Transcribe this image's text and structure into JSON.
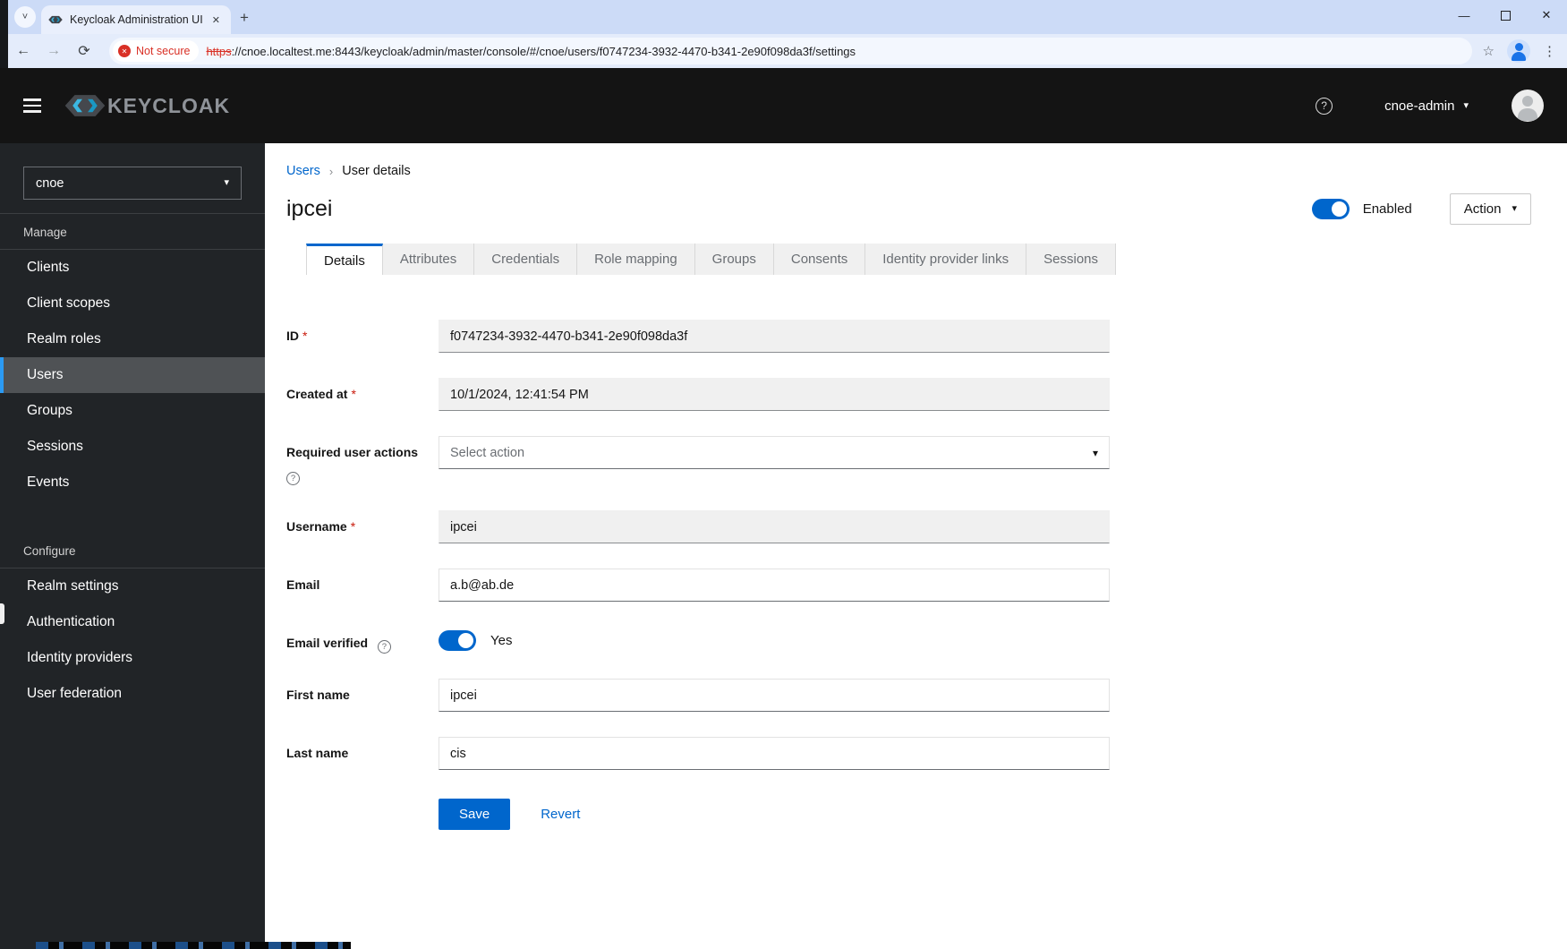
{
  "browser": {
    "tab_title": "Keycloak Administration UI",
    "not_secure": "Not secure",
    "url_scheme": "https",
    "url_rest": "://cnoe.localtest.me:8443/keycloak/admin/master/console/#/cnoe/users/f0747234-3932-4470-b341-2e90f098da3f/settings"
  },
  "masthead": {
    "brand": "KEYCLOAK",
    "user": "cnoe-admin"
  },
  "sidebar": {
    "realm": "cnoe",
    "manage_title": "Manage",
    "configure_title": "Configure",
    "manage_items": [
      "Clients",
      "Client scopes",
      "Realm roles",
      "Users",
      "Groups",
      "Sessions",
      "Events"
    ],
    "configure_items": [
      "Realm settings",
      "Authentication",
      "Identity providers",
      "User federation"
    ],
    "active_item": "Users"
  },
  "page": {
    "breadcrumb": {
      "parent": "Users",
      "current": "User details"
    },
    "title": "ipcei",
    "enabled_label": "Enabled",
    "action_label": "Action",
    "tabs": [
      "Details",
      "Attributes",
      "Credentials",
      "Role mapping",
      "Groups",
      "Consents",
      "Identity provider links",
      "Sessions"
    ],
    "active_tab": "Details"
  },
  "form": {
    "required_marker": "*",
    "id": {
      "label": "ID",
      "value": "f0747234-3932-4470-b341-2e90f098da3f"
    },
    "created_at": {
      "label": "Created at",
      "value": "10/1/2024, 12:41:54 PM"
    },
    "required_actions": {
      "label": "Required user actions",
      "placeholder": "Select action"
    },
    "username": {
      "label": "Username",
      "value": "ipcei"
    },
    "email": {
      "label": "Email",
      "value": "a.b@ab.de"
    },
    "email_verified": {
      "label": "Email verified",
      "state": "Yes"
    },
    "first_name": {
      "label": "First name",
      "value": "ipcei"
    },
    "last_name": {
      "label": "Last name",
      "value": "cis"
    },
    "save": "Save",
    "revert": "Revert"
  },
  "icons": {
    "chevron_down": "▾",
    "chevron_down_small": "˅",
    "breadcrumb_sep": "›",
    "help": "?",
    "close": "✕",
    "minimize": "—",
    "back": "←",
    "forward": "→",
    "reload": "⟳",
    "star": "☆",
    "menu_dots": "⋮",
    "plus": "+",
    "not_secure_x": "✕"
  },
  "colors": {
    "accent": "#0066cc",
    "nav_active_bar": "#2b9af3",
    "danger": "#c9190b",
    "masthead": "#141414",
    "sidebar": "#212427"
  }
}
